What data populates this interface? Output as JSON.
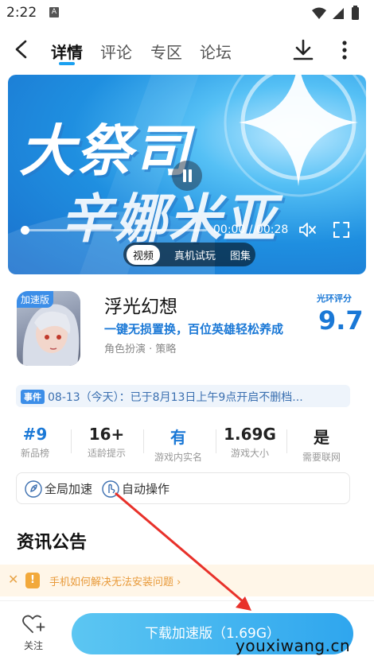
{
  "status_bar": {
    "time": "2:22",
    "notif_glyph": "A"
  },
  "nav": {
    "tabs": [
      {
        "label": "详情",
        "active": true
      },
      {
        "label": "评论",
        "active": false
      },
      {
        "label": "专区",
        "active": false
      },
      {
        "label": "论坛",
        "active": false
      }
    ]
  },
  "video": {
    "title_line1": "大祭司",
    "title_line2": "辛娜米亚",
    "time": "00:00 / 00:28",
    "progress": 0.0,
    "tabs": [
      "视频",
      "真机试玩",
      "图集"
    ]
  },
  "app": {
    "badge": "加速版",
    "name": "浮光幻想",
    "slogan": "一键无损置换，百位英雄轻松养成",
    "genre": "角色扮演 · 策略",
    "rating_label": "光环评分",
    "rating": "9.7"
  },
  "event": {
    "tag": "事件",
    "text": "08-13（今天）：已于8月13日上午9点开启不删档..."
  },
  "stats": [
    {
      "value": "#9",
      "label": "新品榜"
    },
    {
      "value": "16+",
      "label": "适龄提示"
    },
    {
      "value": "有",
      "label": "游戏内实名"
    },
    {
      "value": "1.69G",
      "label": "游戏大小"
    },
    {
      "value": "是",
      "label": "需要联网"
    }
  ],
  "features": [
    "全局加速",
    "自动操作"
  ],
  "section": {
    "title": "资讯公告"
  },
  "tip": {
    "text": "手机如何解决无法安装问题 ›"
  },
  "bottom": {
    "follow_label": "关注",
    "download_label": "下载加速版（1.69G）"
  },
  "watermark": "youxiwang.cn",
  "colors": {
    "accent": "#1a78d6",
    "button": "#2fa6ee",
    "arrow": "#e8312a"
  }
}
